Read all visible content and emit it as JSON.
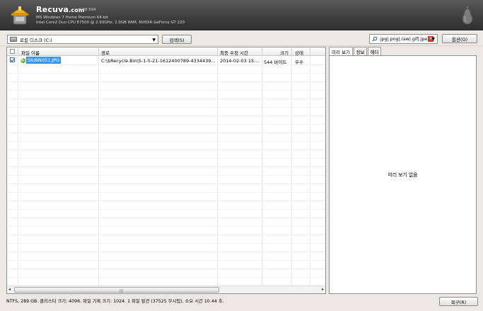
{
  "header": {
    "brand_name": "Recuva",
    "brand_suffix": ".com",
    "version": "v1.38.504",
    "os_line": "MS Windows 7 Home Premium 64-bit",
    "hw_line": "Intel Core2 Duo CPU E7500 @ 2.93GHz, 2.0GB RAM, NVIDIA GeForce GT 220"
  },
  "toolbar": {
    "drive_value": "로컬 디스크 (C:)",
    "search_label": "검색(S)",
    "filter_value": ".jpg|.png|.raw|.gif|.jpe",
    "options_label": "옵션(O)"
  },
  "table": {
    "columns": [
      "파일 이름",
      "경로",
      "최종 수정 시간",
      "크기",
      "상태"
    ],
    "rows": [
      {
        "checked": true,
        "name": "SIU6N051.JPG",
        "path": "C:\\$Recycle.Bin\\S-1-5-21-1612400789-4334439...",
        "modified": "2014-02-03 15:...",
        "size": "544 바이트",
        "state": "우수"
      }
    ]
  },
  "preview": {
    "tabs": [
      "미리 보기",
      "정보",
      "헤더"
    ],
    "empty_text": "미리 보기 없음"
  },
  "status": {
    "text": "NTFS, 289 GB. 클러스터 크기: 4096. 파일 기록 크기: 1024. 1 파일 발견 (37525 무시됨), 소요 시간 10.44 초."
  },
  "actions": {
    "recover_label": "복구(R)"
  },
  "colors": {
    "header_bg": "#3d3d3d",
    "selection": "#3399ff",
    "state_good": "#54b235",
    "filter_clear": "#d6332b"
  },
  "icons": [
    "recuva-logo-icon",
    "pear-icon",
    "drive-icon",
    "dropdown-arrow-icon",
    "search-filter-icon",
    "clear-filter-icon",
    "status-good-icon",
    "checkbox-icon"
  ]
}
